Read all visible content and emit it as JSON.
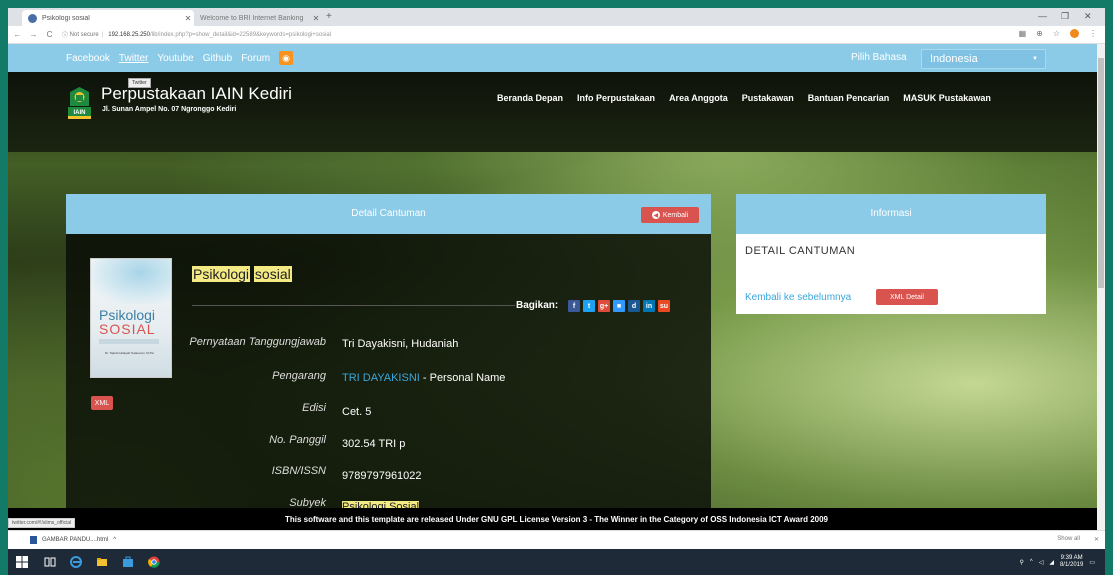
{
  "browser": {
    "tabs": [
      {
        "title": "Psikologi sosial",
        "active": true
      },
      {
        "title": "Welcome to BRI Internet Banking",
        "active": false
      }
    ],
    "address": {
      "security": "Not secure",
      "host": "192.168.25.250",
      "path": "/lib/index.php?p=show_detail&id=22589&keywords=psikologi+sosial"
    },
    "status_url": "twitter.com/#!/slims_official"
  },
  "topbar": {
    "social_links": [
      "Facebook",
      "Twitter",
      "Youtube",
      "Github",
      "Forum"
    ],
    "language_label": "Pilih Bahasa",
    "language_value": "Indonesia"
  },
  "header": {
    "tooltip": "Twitter",
    "title": "Perpustakaan IAIN Kediri",
    "address": "Jl. Sunan Ampel No. 07 Ngronggo Kediri",
    "nav": [
      "Beranda Depan",
      "Info Perpustakaan",
      "Area Anggota",
      "Pustakawan",
      "Bantuan Pencarian",
      "MASUK Pustakawan"
    ]
  },
  "detail": {
    "panel_title": "Detail Cantuman",
    "back_button": "Kembali",
    "book_title_word1": "Psikologi",
    "book_title_word2": "sosial",
    "cover": {
      "line1": "Psikologi",
      "line2": "SOSIAL",
      "author": "Dr. Tajriah Hidayah Sulaeman, M.Psi"
    },
    "xml_badge": "XML",
    "share_label": "Bagikan:",
    "share_icons": [
      "facebook-icon",
      "twitter-icon",
      "google-plus-icon",
      "delicious-icon",
      "digg-icon",
      "linkedin-icon",
      "stumbleupon-icon"
    ],
    "fields": [
      {
        "label": "Pernyataan Tanggungjawab",
        "value": "Tri Dayakisni, Hudaniah"
      },
      {
        "label": "Pengarang",
        "value_link": "TRI DAYAKISNI",
        "value_suffix": " - Personal Name"
      },
      {
        "label": "Edisi",
        "value": "Cet. 5"
      },
      {
        "label": "No. Panggil",
        "value": "302.54 TRI p"
      },
      {
        "label": "ISBN/ISSN",
        "value": "9789797961022"
      },
      {
        "label": "Subyek",
        "value": "Psikologi Sosial"
      }
    ]
  },
  "info": {
    "panel_title": "Informasi",
    "detail_heading": "DETAIL CANTUMAN",
    "back_link": "Kembali ke sebelumnya",
    "xml_detail_button": "XML Detail"
  },
  "footer": {
    "text": "This software and this template are released Under GNU GPL License Version 3 - The Winner in the Category of OSS Indonesia ICT Award 2009"
  },
  "download_bar": {
    "file": "GAMBAR PANDU....html",
    "show_all": "Show all"
  },
  "taskbar": {
    "time": "9:39 AM",
    "date": "8/1/2019"
  },
  "colors": {
    "accent_blue": "#8ccbe8",
    "button_red": "#d9534f",
    "highlight_yellow": "#f3ea84",
    "frame_teal": "#137a68"
  }
}
